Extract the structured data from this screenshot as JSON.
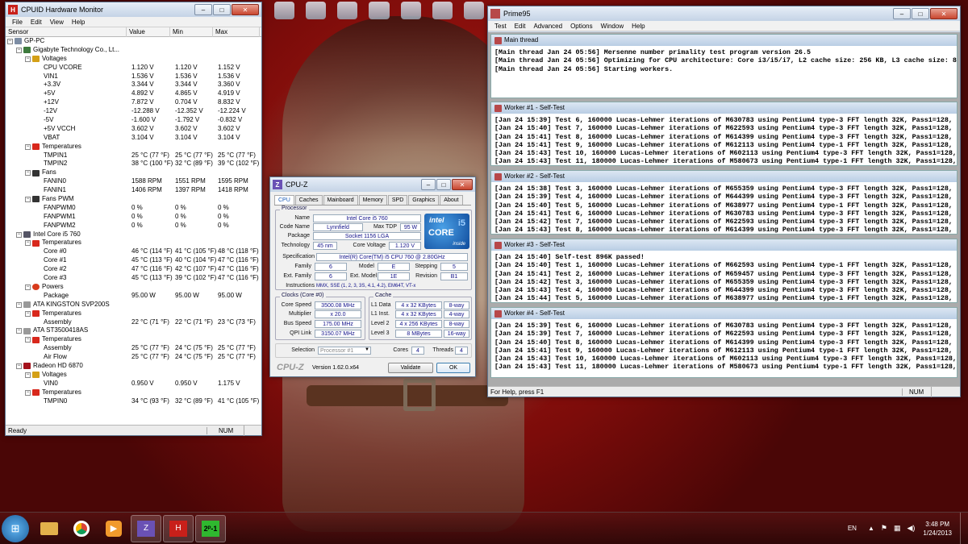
{
  "hwmonitor": {
    "title": "CPUID Hardware Monitor",
    "menu": [
      "File",
      "Edit",
      "View",
      "Help"
    ],
    "columns": [
      "Sensor",
      "Value",
      "Min",
      "Max"
    ],
    "rows": [
      {
        "level": 0,
        "icon": "pc",
        "toggle": true,
        "name": "GP-PC",
        "value": "",
        "min": "",
        "max": ""
      },
      {
        "level": 1,
        "icon": "mb",
        "toggle": true,
        "name": "Gigabyte Technology Co., Lt...",
        "value": "",
        "min": "",
        "max": ""
      },
      {
        "level": 2,
        "icon": "volt",
        "toggle": true,
        "name": "Voltages",
        "value": "",
        "min": "",
        "max": ""
      },
      {
        "level": 3,
        "name": "CPU VCORE",
        "value": "1.120 V",
        "min": "1.120 V",
        "max": "1.152 V"
      },
      {
        "level": 3,
        "name": "VIN1",
        "value": "1.536 V",
        "min": "1.536 V",
        "max": "1.536 V"
      },
      {
        "level": 3,
        "name": "+3.3V",
        "value": "3.344 V",
        "min": "3.344 V",
        "max": "3.360 V"
      },
      {
        "level": 3,
        "name": "+5V",
        "value": "4.892 V",
        "min": "4.865 V",
        "max": "4.919 V"
      },
      {
        "level": 3,
        "name": "+12V",
        "value": "7.872 V",
        "min": "0.704 V",
        "max": "8.832 V"
      },
      {
        "level": 3,
        "name": "-12V",
        "value": "-12.288 V",
        "min": "-12.352 V",
        "max": "-12.224 V"
      },
      {
        "level": 3,
        "name": "-5V",
        "value": "-1.600 V",
        "min": "-1.792 V",
        "max": "-0.832 V"
      },
      {
        "level": 3,
        "name": "+5V VCCH",
        "value": "3.602 V",
        "min": "3.602 V",
        "max": "3.602 V"
      },
      {
        "level": 3,
        "name": "VBAT",
        "value": "3.104 V",
        "min": "3.104 V",
        "max": "3.104 V"
      },
      {
        "level": 2,
        "icon": "temp",
        "toggle": true,
        "name": "Temperatures",
        "value": "",
        "min": "",
        "max": ""
      },
      {
        "level": 3,
        "name": "TMPIN1",
        "value": "25 °C (77 °F)",
        "min": "25 °C (77 °F)",
        "max": "25 °C (77 °F)"
      },
      {
        "level": 3,
        "name": "TMPIN2",
        "value": "38 °C (100 °F)",
        "min": "32 °C (89 °F)",
        "max": "39 °C (102 °F)"
      },
      {
        "level": 2,
        "icon": "fan",
        "toggle": true,
        "name": "Fans",
        "value": "",
        "min": "",
        "max": ""
      },
      {
        "level": 3,
        "name": "FANIN0",
        "value": "1588 RPM",
        "min": "1551 RPM",
        "max": "1595 RPM"
      },
      {
        "level": 3,
        "name": "FANIN1",
        "value": "1406 RPM",
        "min": "1397 RPM",
        "max": "1418 RPM"
      },
      {
        "level": 2,
        "icon": "fan",
        "toggle": true,
        "name": "Fans PWM",
        "value": "",
        "min": "",
        "max": ""
      },
      {
        "level": 3,
        "name": "FANPWM0",
        "value": "0 %",
        "min": "0 %",
        "max": "0 %"
      },
      {
        "level": 3,
        "name": "FANPWM1",
        "value": "0 %",
        "min": "0 %",
        "max": "0 %"
      },
      {
        "level": 3,
        "name": "FANPWM2",
        "value": "0 %",
        "min": "0 %",
        "max": "0 %"
      },
      {
        "level": 1,
        "icon": "cpu",
        "toggle": true,
        "name": "Intel Core i5 760",
        "value": "",
        "min": "",
        "max": ""
      },
      {
        "level": 2,
        "icon": "temp",
        "toggle": true,
        "name": "Temperatures",
        "value": "",
        "min": "",
        "max": ""
      },
      {
        "level": 3,
        "name": "Core #0",
        "value": "46 °C (114 °F)",
        "min": "41 °C (105 °F)",
        "max": "48 °C (118 °F)"
      },
      {
        "level": 3,
        "name": "Core #1",
        "value": "45 °C (113 °F)",
        "min": "40 °C (104 °F)",
        "max": "47 °C (116 °F)"
      },
      {
        "level": 3,
        "name": "Core #2",
        "value": "47 °C (116 °F)",
        "min": "42 °C (107 °F)",
        "max": "47 °C (116 °F)"
      },
      {
        "level": 3,
        "name": "Core #3",
        "value": "45 °C (113 °F)",
        "min": "39 °C (102 °F)",
        "max": "47 °C (116 °F)"
      },
      {
        "level": 2,
        "icon": "pow",
        "toggle": true,
        "name": "Powers",
        "value": "",
        "min": "",
        "max": ""
      },
      {
        "level": 3,
        "name": "Package",
        "value": "95.00 W",
        "min": "95.00 W",
        "max": "95.00 W"
      },
      {
        "level": 1,
        "icon": "hdd",
        "toggle": true,
        "name": "ATA KINGSTON SVP200S",
        "value": "",
        "min": "",
        "max": ""
      },
      {
        "level": 2,
        "icon": "temp",
        "toggle": true,
        "name": "Temperatures",
        "value": "",
        "min": "",
        "max": ""
      },
      {
        "level": 3,
        "name": "Assembly",
        "value": "22 °C (71 °F)",
        "min": "22 °C (71 °F)",
        "max": "23 °C (73 °F)"
      },
      {
        "level": 1,
        "icon": "hdd",
        "toggle": true,
        "name": "ATA ST3500418AS",
        "value": "",
        "min": "",
        "max": ""
      },
      {
        "level": 2,
        "icon": "temp",
        "toggle": true,
        "name": "Temperatures",
        "value": "",
        "min": "",
        "max": ""
      },
      {
        "level": 3,
        "name": "Assembly",
        "value": "25 °C (77 °F)",
        "min": "24 °C (75 °F)",
        "max": "25 °C (77 °F)"
      },
      {
        "level": 3,
        "name": "Air Flow",
        "value": "25 °C (77 °F)",
        "min": "24 °C (75 °F)",
        "max": "25 °C (77 °F)"
      },
      {
        "level": 1,
        "icon": "gpu",
        "toggle": true,
        "name": "Radeon HD 6870",
        "value": "",
        "min": "",
        "max": ""
      },
      {
        "level": 2,
        "icon": "volt",
        "toggle": true,
        "name": "Voltages",
        "value": "",
        "min": "",
        "max": ""
      },
      {
        "level": 3,
        "name": "VIN0",
        "value": "0.950 V",
        "min": "0.950 V",
        "max": "1.175 V"
      },
      {
        "level": 2,
        "icon": "temp",
        "toggle": true,
        "name": "Temperatures",
        "value": "",
        "min": "",
        "max": ""
      },
      {
        "level": 3,
        "name": "TMPIN0",
        "value": "34 °C (93 °F)",
        "min": "32 °C (89 °F)",
        "max": "41 °C (105 °F)"
      }
    ],
    "status": "Ready",
    "status_num": "NUM"
  },
  "prime95": {
    "title": "Prime95",
    "menu": [
      "Test",
      "Edit",
      "Advanced",
      "Options",
      "Window",
      "Help"
    ],
    "panes": [
      {
        "title": "Main thread",
        "lines": [
          "[Main thread Jan 24 05:56] Mersenne number primality test program version 26.5",
          "[Main thread Jan 24 05:56] Optimizing for CPU architecture: Core i3/i5/i7, L2 cache size: 256 KB, L3 cache size: 8 MB",
          "[Main thread Jan 24 05:56] Starting workers."
        ]
      },
      {
        "title": "Worker #1 - Self-Test",
        "lines": [
          "[Jan 24 15:39] Test 6, 160000 Lucas-Lehmer iterations of M630783 using Pentium4 type-3 FFT length 32K, Pass1=128, Pass2=256.",
          "[Jan 24 15:40] Test 7, 160000 Lucas-Lehmer iterations of M622593 using Pentium4 type-3 FFT length 32K, Pass1=128, Pass2=256.",
          "[Jan 24 15:41] Test 8, 160000 Lucas-Lehmer iterations of M614399 using Pentium4 type-3 FFT length 32K, Pass1=128, Pass2=256.",
          "[Jan 24 15:41] Test 9, 160000 Lucas-Lehmer iterations of M612113 using Pentium4 type-1 FFT length 32K, Pass1=128, Pass2=256.",
          "[Jan 24 15:43] Test 10, 160000 Lucas-Lehmer iterations of M602113 using Pentium4 type-3 FFT length 32K, Pass1=128, Pass2=256.",
          "[Jan 24 15:43] Test 11, 180000 Lucas-Lehmer iterations of M580673 using Pentium4 type-1 FFT length 32K, Pass1=128, Pass2=256."
        ]
      },
      {
        "title": "Worker #2 - Self-Test",
        "lines": [
          "[Jan 24 15:38] Test 3, 160000 Lucas-Lehmer iterations of M655359 using Pentium4 type-3 FFT length 32K, Pass1=128, Pass2=256.",
          "[Jan 24 15:39] Test 4, 160000 Lucas-Lehmer iterations of M644399 using Pentium4 type-3 FFT length 32K, Pass1=128, Pass2=256.",
          "[Jan 24 15:40] Test 5, 160000 Lucas-Lehmer iterations of M638977 using Pentium4 type-1 FFT length 32K, Pass1=128, Pass2=256.",
          "[Jan 24 15:41] Test 6, 160000 Lucas-Lehmer iterations of M630783 using Pentium4 type-3 FFT length 32K, Pass1=128, Pass2=256.",
          "[Jan 24 15:42] Test 7, 160000 Lucas-Lehmer iterations of M622593 using Pentium4 type-3 FFT length 32K, Pass1=128, Pass2=256.",
          "[Jan 24 15:43] Test 8, 160000 Lucas-Lehmer iterations of M614399 using Pentium4 type-3 FFT length 32K, Pass1=128, Pass2=256."
        ]
      },
      {
        "title": "Worker #3 - Self-Test",
        "lines": [
          "[Jan 24 15:40] Self-test 896K passed!",
          "[Jan 24 15:40] Test 1, 160000 Lucas-Lehmer iterations of M662593 using Pentium4 type-1 FFT length 32K, Pass1=128, Pass2=256.",
          "[Jan 24 15:41] Test 2, 160000 Lucas-Lehmer iterations of M659457 using Pentium4 type-3 FFT length 32K, Pass1=128, Pass2=256.",
          "[Jan 24 15:42] Test 3, 160000 Lucas-Lehmer iterations of M655359 using Pentium4 type-3 FFT length 32K, Pass1=128, Pass2=256.",
          "[Jan 24 15:43] Test 4, 160000 Lucas-Lehmer iterations of M644399 using Pentium4 type-3 FFT length 32K, Pass1=128, Pass2=256.",
          "[Jan 24 15:44] Test 5, 160000 Lucas-Lehmer iterations of M638977 using Pentium4 type-1 FFT length 32K, Pass1=128, Pass2=256."
        ]
      },
      {
        "title": "Worker #4 - Self-Test",
        "lines": [
          "[Jan 24 15:39] Test 6, 160000 Lucas-Lehmer iterations of M630783 using Pentium4 type-3 FFT length 32K, Pass1=128, Pass2=256.",
          "[Jan 24 15:39] Test 7, 160000 Lucas-Lehmer iterations of M622593 using Pentium4 type-3 FFT length 32K, Pass1=128, Pass2=256.",
          "[Jan 24 15:40] Test 8, 160000 Lucas-Lehmer iterations of M614399 using Pentium4 type-3 FFT length 32K, Pass1=128, Pass2=256.",
          "[Jan 24 15:41] Test 9, 160000 Lucas-Lehmer iterations of M612113 using Pentium4 type-1 FFT length 32K, Pass1=128, Pass2=256.",
          "[Jan 24 15:43] Test 10, 160000 Lucas-Lehmer iterations of M602113 using Pentium4 type-3 FFT length 32K, Pass1=128, Pass2=256.",
          "[Jan 24 15:43] Test 11, 180000 Lucas-Lehmer iterations of M580673 using Pentium4 type-1 FFT length 32K, Pass1=128, Pass2=256."
        ]
      }
    ],
    "status": "For Help, press F1",
    "status_num": "NUM"
  },
  "cpuz": {
    "title": "CPU-Z",
    "tabs": [
      "CPU",
      "Caches",
      "Mainboard",
      "Memory",
      "SPD",
      "Graphics",
      "About"
    ],
    "active_tab": "CPU",
    "processor_group": "Processor",
    "labels": {
      "name": "Name",
      "code_name": "Code Name",
      "max_tdp": "Max TDP",
      "package": "Package",
      "technology": "Technology",
      "core_voltage": "Core Voltage",
      "specification": "Specification",
      "family": "Family",
      "model": "Model",
      "stepping": "Stepping",
      "ext_family": "Ext. Family",
      "ext_model": "Ext. Model",
      "revision": "Revision",
      "instructions": "Instructions",
      "core_speed": "Core Speed",
      "multiplier": "Multiplier",
      "bus_speed": "Bus Speed",
      "qpi_link": "QPI Link",
      "l1_data": "L1 Data",
      "l1_inst": "L1 Inst.",
      "level2": "Level 2",
      "level3": "Level 3",
      "selection": "Selection",
      "cores": "Cores",
      "threads": "Threads"
    },
    "values": {
      "name": "Intel Core i5 760",
      "code_name": "Lynnfield",
      "max_tdp": "95 W",
      "package": "Socket 1156 LGA",
      "technology": "45 nm",
      "core_voltage": "1.120 V",
      "specification": "Intel(R) Core(TM) i5 CPU       760  @ 2.80GHz",
      "family": "6",
      "model": "E",
      "stepping": "5",
      "ext_family": "6",
      "ext_model": "1E",
      "revision": "B1",
      "instructions": "MMX, SSE (1, 2, 3, 3S, 4.1, 4.2), EM64T, VT-x",
      "core_speed": "3500.08 MHz",
      "multiplier": "x 20.0",
      "bus_speed": "175.00 MHz",
      "qpi_link": "3150.07 MHz",
      "l1_data": "4 x 32 KBytes",
      "l1_data_way": "8-way",
      "l1_inst": "4 x 32 KBytes",
      "l1_inst_way": "4-way",
      "level2": "4 x 256 KBytes",
      "level2_way": "8-way",
      "level3": "8 MBytes",
      "level3_way": "16-way",
      "selection": "Processor #1",
      "cores": "4",
      "threads": "4"
    },
    "clocks_group": "Clocks (Core #0)",
    "cache_group": "Cache",
    "intel_logo": {
      "brand": "intel",
      "line": "CORE",
      "model": "i5",
      "tag": "inside"
    },
    "brand": "CPU-Z",
    "version": "Version 1.62.0.x64",
    "validate_label": "Validate",
    "ok_label": "OK"
  },
  "tray": {
    "lang": "EN",
    "time": "3:48 PM",
    "date": "1/24/2013"
  },
  "colors": {
    "accent": "#1a5cb8",
    "prime_icon": "#b7484a",
    "hw_icon": "#c8201a"
  }
}
